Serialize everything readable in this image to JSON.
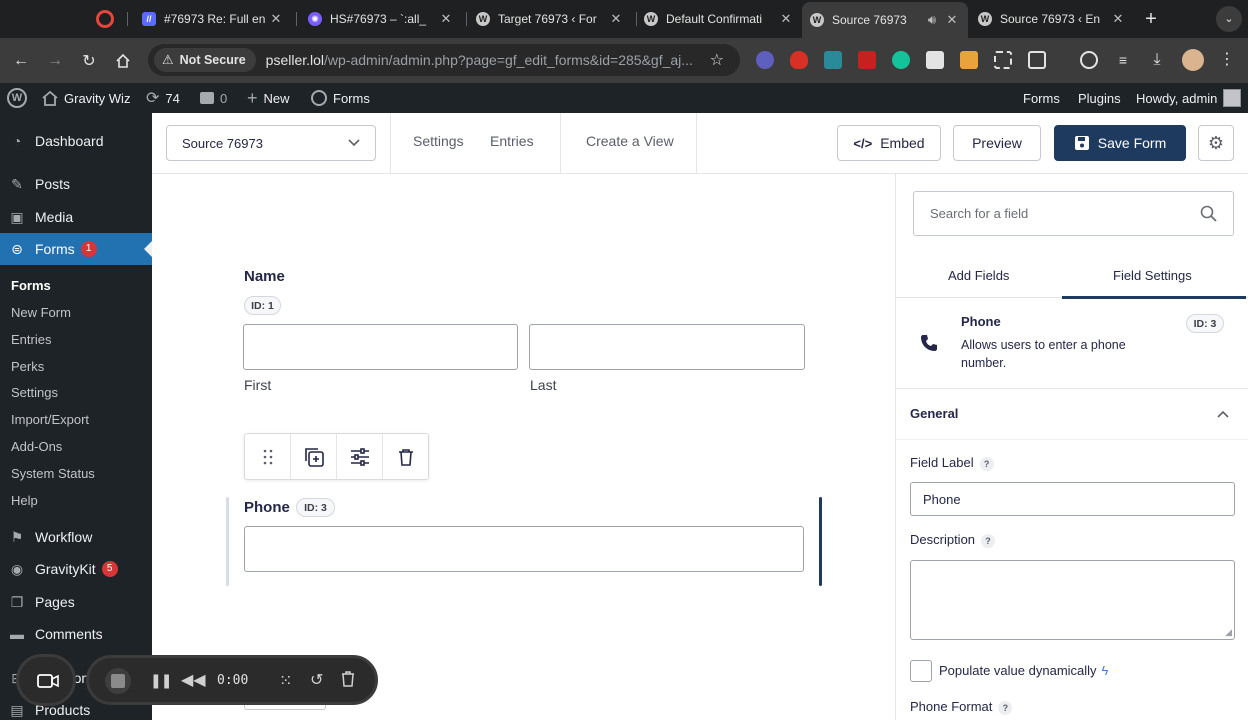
{
  "browser": {
    "tabs": [
      {
        "title": "#76973 Re: Full en",
        "active": false
      },
      {
        "title": "HS#76973 – `:all_",
        "active": false
      },
      {
        "title": "Target 76973 ‹ For",
        "active": false
      },
      {
        "title": "Default Confirmati",
        "active": false
      },
      {
        "title": "Source 76973",
        "active": true
      },
      {
        "title": "Source 76973 ‹ En",
        "active": false
      }
    ],
    "new_tab": "+",
    "not_secure": "Not Secure",
    "url_host": "pseller.lol",
    "url_path": "/wp-admin/admin.php?page=gf_edit_forms&id=285&gf_aj..."
  },
  "adminbar": {
    "site_name": "Gravity Wiz",
    "updates": "74",
    "comments": "0",
    "new": "New",
    "forms": "Forms",
    "right_forms": "Forms",
    "plugins": "Plugins",
    "howdy": "Howdy, admin"
  },
  "sidebar": {
    "items": [
      {
        "label": "Dashboard",
        "icon": "dashboard-icon"
      },
      {
        "label": "Posts",
        "icon": "pin-icon"
      },
      {
        "label": "Media",
        "icon": "media-icon"
      },
      {
        "label": "Forms",
        "icon": "gravityforms-icon",
        "badge": "1",
        "active": true
      },
      {
        "label": "Workflow",
        "icon": "workflow-icon"
      },
      {
        "label": "GravityKit",
        "icon": "gravitykit-icon",
        "badge": "5"
      },
      {
        "label": "Pages",
        "icon": "pages-icon"
      },
      {
        "label": "Comments",
        "icon": "comments-icon"
      },
      {
        "label": "WooCom",
        "icon": "woo-icon"
      },
      {
        "label": "Products",
        "icon": "products-icon"
      }
    ],
    "submenu": [
      "Forms",
      "New Form",
      "Entries",
      "Perks",
      "Settings",
      "Import/Export",
      "Add-Ons",
      "System Status",
      "Help"
    ]
  },
  "toolbar": {
    "form_name": "Source 76973",
    "settings": "Settings",
    "entries": "Entries",
    "create_view": "Create a View",
    "embed": "Embed",
    "preview": "Preview",
    "save": "Save Form"
  },
  "canvas": {
    "name_field": {
      "label": "Name",
      "id": "ID: 1",
      "first": "First",
      "last": "Last"
    },
    "phone_field": {
      "label": "Phone",
      "id": "ID: 3"
    }
  },
  "panel": {
    "search_placeholder": "Search for a field",
    "tabs": [
      "Add Fields",
      "Field Settings"
    ],
    "active_tab": "Field Settings",
    "field_type": "Phone",
    "field_id": "ID: 3",
    "field_desc": "Allows users to enter a phone number.",
    "section": "General",
    "field_label_label": "Field Label",
    "field_label_value": "Phone",
    "description_label": "Description",
    "populate_label": "Populate value dynamically",
    "phone_format_label": "Phone Format",
    "help": "?"
  },
  "recorder": {
    "time": "0:00"
  },
  "colors": {
    "wp_blue": "#2271b1",
    "admin_dark": "#1d2327",
    "save_blue": "#1e3a5f",
    "badge_red": "#d63638"
  }
}
